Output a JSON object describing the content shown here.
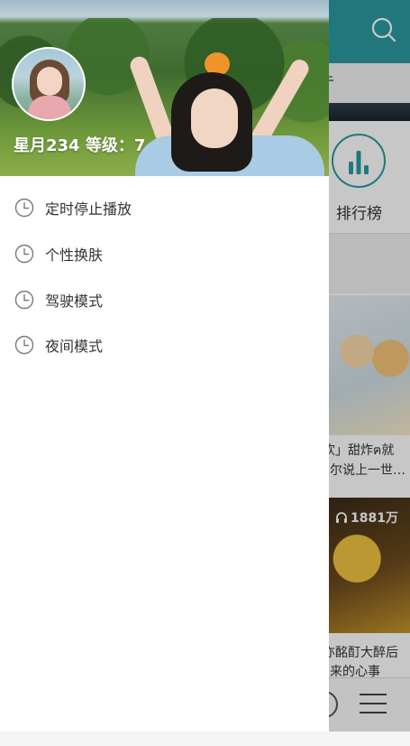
{
  "background_screen": {
    "tab_partial_text": "亍",
    "rank_label": "排行榜",
    "card1": {
      "title_line1": "欢」甜炸ฅ就",
      "title_line2": "尔说上一世…"
    },
    "card2": {
      "plays": "1881万",
      "title_line1": "亦酩酊大醉后",
      "title_line2": "来的心事"
    },
    "icons": [
      "search-icon",
      "chart-bars-icon",
      "headphones-icon",
      "circle-icon",
      "hamburger-menu-icon"
    ],
    "colors": {
      "topbar": "#2a9aa0",
      "accent": "#2a9aa0"
    }
  },
  "drawer": {
    "user_line": "星月234 等级：7",
    "menu": [
      {
        "label": "定时停止播放",
        "icon": "clock-icon"
      },
      {
        "label": "个性换肤",
        "icon": "clock-icon"
      },
      {
        "label": "驾驶模式",
        "icon": "clock-icon"
      },
      {
        "label": "夜间模式",
        "icon": "clock-icon"
      }
    ]
  }
}
